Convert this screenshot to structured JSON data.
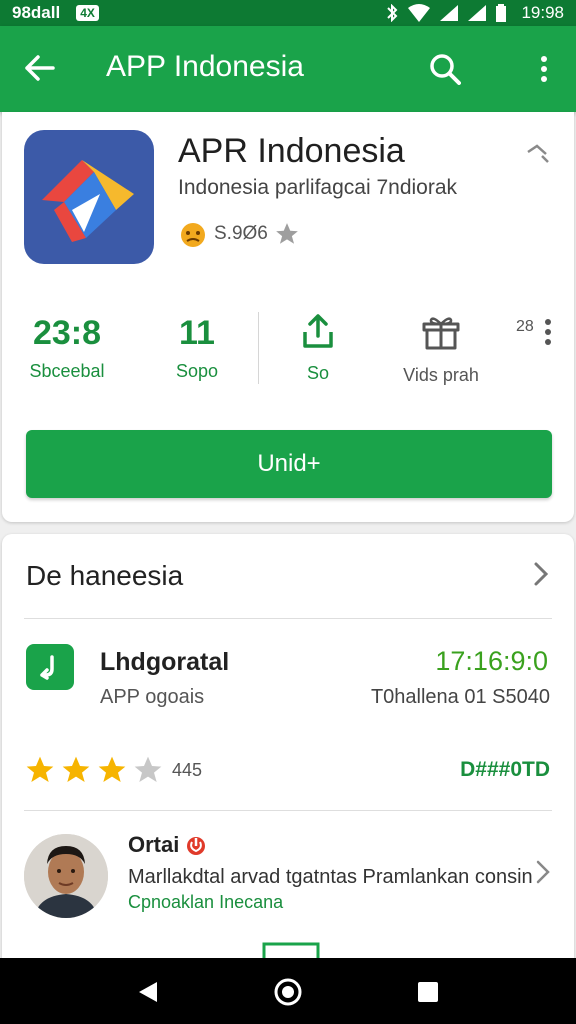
{
  "status_bar": {
    "left_text": "98dall",
    "badge": "4X",
    "time": "19:98"
  },
  "app_bar": {
    "title": "APP Indonesia",
    "icons": [
      "back-arrow-icon",
      "search-icon",
      "more-vert-icon"
    ]
  },
  "app": {
    "name": "APR Indonesia",
    "subtitle": "Indonesia parlifagcai 7ndiorak",
    "rating_text": "S.9Ø6",
    "accent_color": "#1aa34a"
  },
  "stats": [
    {
      "value": "23:8",
      "label": "Sbceebal"
    },
    {
      "value": "11",
      "label": "Sopo"
    },
    {
      "value": "",
      "label": "So"
    },
    {
      "value": "",
      "label": "Vids prah"
    },
    {
      "value": "28",
      "label": ""
    }
  ],
  "install_button": {
    "label": "Unid+"
  },
  "section": {
    "title": "De haneesia"
  },
  "update": {
    "title": "Lhdgoratal",
    "time": "17:16:9:0",
    "app_label": "APP ogoais",
    "size_text": "T0hallena 01 S5040"
  },
  "rating": {
    "stars_filled": 3,
    "stars_total": 4,
    "count": "445",
    "code": "D###0TD"
  },
  "review": {
    "name": "Ortai",
    "text": "Marllakdtal arvad tgatntas Pramlankan consin",
    "link": "Cpnoaklan Inecana"
  }
}
